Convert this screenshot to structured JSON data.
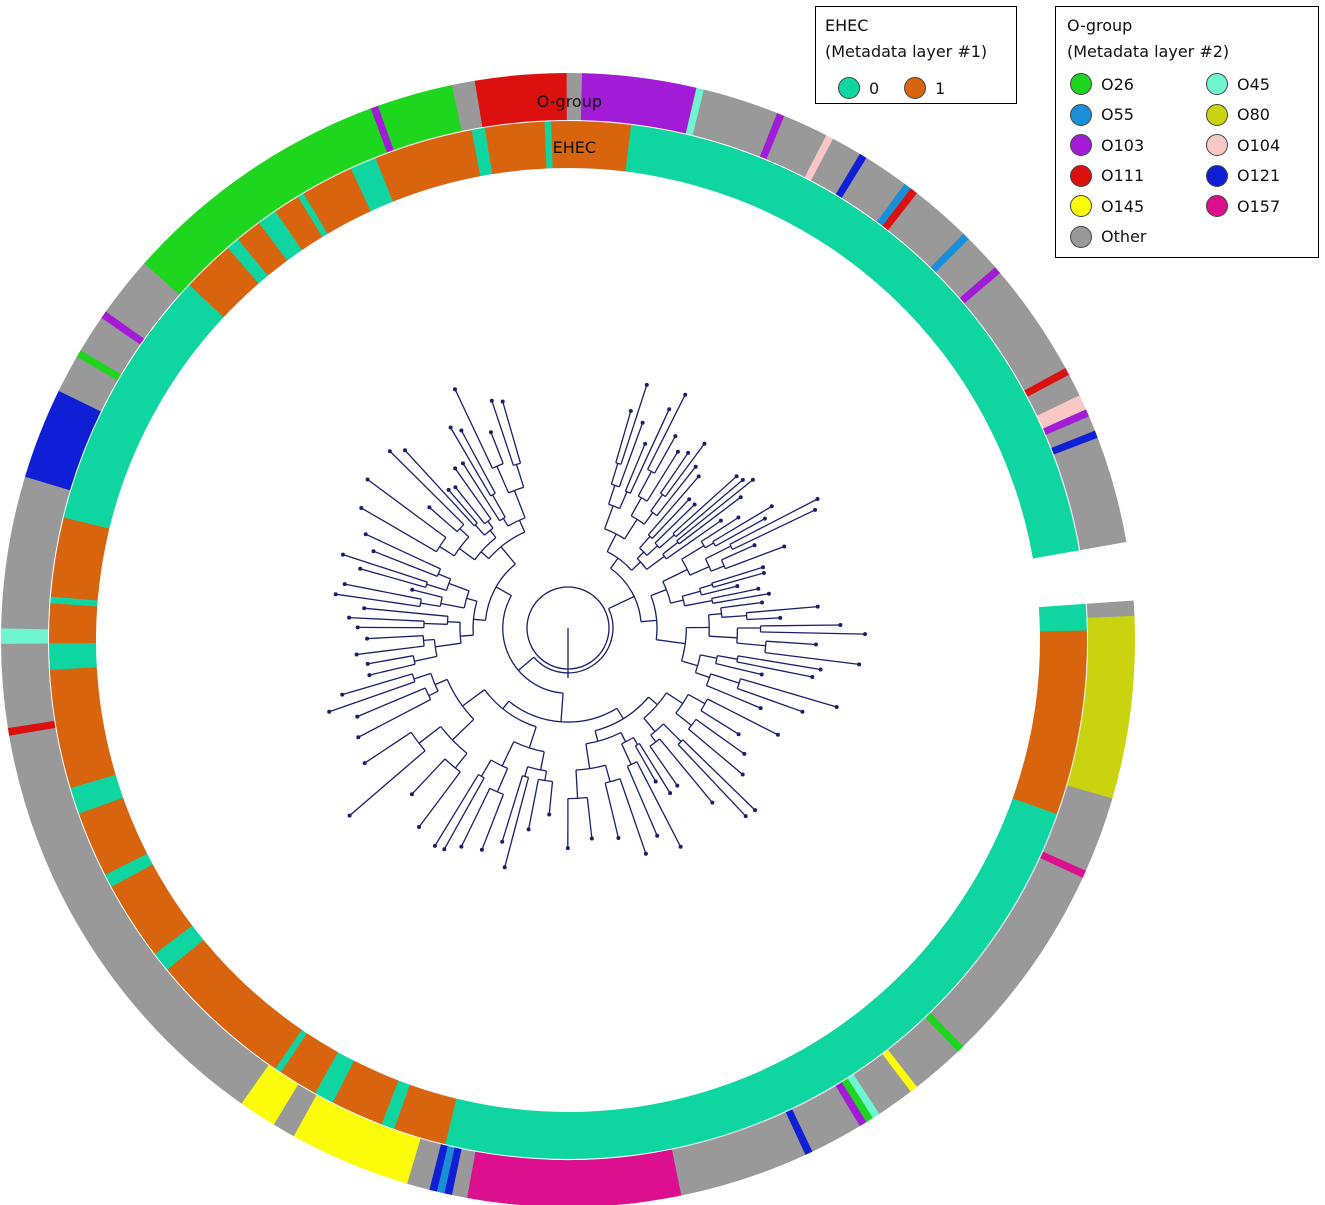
{
  "figure": {
    "ring_labels": {
      "outer": "O-group",
      "inner": "EHEC"
    },
    "tree_color": "#1b1f6b"
  },
  "legend_ehec": {
    "title_line1": "EHEC",
    "title_line2": "(Metadata layer #1)",
    "items": [
      {
        "label": "0",
        "color": "#0fd6a0"
      },
      {
        "label": "1",
        "color": "#d8640e"
      }
    ]
  },
  "legend_ogroup": {
    "title_line1": "O-group",
    "title_line2": "(Metadata layer #2)",
    "items": [
      {
        "label": "O26",
        "color": "#1ed61e",
        "icon": "circle-swatch"
      },
      {
        "label": "O45",
        "color": "#6ff5d0",
        "icon": "circle-swatch"
      },
      {
        "label": "O55",
        "color": "#1a8fd8",
        "icon": "circle-swatch"
      },
      {
        "label": "O80",
        "color": "#c9d30f",
        "icon": "circle-swatch"
      },
      {
        "label": "O103",
        "color": "#a21bd6",
        "icon": "circle-swatch"
      },
      {
        "label": "O104",
        "color": "#f9c7c4",
        "icon": "circle-swatch"
      },
      {
        "label": "O111",
        "color": "#dd1010",
        "icon": "circle-swatch"
      },
      {
        "label": "O121",
        "color": "#0e1fd6",
        "icon": "circle-swatch"
      },
      {
        "label": "O145",
        "color": "#fbfb0a",
        "icon": "circle-swatch"
      },
      {
        "label": "O157",
        "color": "#dc0f8f",
        "icon": "circle-swatch"
      },
      {
        "label": "Other",
        "color": "#999999",
        "icon": "circle-swatch"
      }
    ]
  },
  "ehec_ring": [
    [
      "0",
      4
    ],
    [
      "1",
      28
    ],
    [
      "0",
      114
    ],
    [
      "1",
      8
    ],
    [
      "0",
      2
    ],
    [
      "1",
      8
    ],
    [
      "0",
      3
    ],
    [
      "1",
      6
    ],
    [
      "0",
      1
    ],
    [
      "1",
      22
    ],
    [
      "0",
      3
    ],
    [
      "1",
      12
    ],
    [
      "0",
      2
    ],
    [
      "1",
      10
    ],
    [
      "0",
      4
    ],
    [
      "1",
      18
    ],
    [
      "0",
      4
    ],
    [
      "1",
      6
    ],
    [
      "0",
      1
    ],
    [
      "1",
      12
    ],
    [
      "0",
      40
    ],
    [
      "1",
      8
    ],
    [
      "0",
      2
    ],
    [
      "1",
      4
    ],
    [
      "0",
      3
    ],
    [
      "1",
      4
    ],
    [
      "0",
      1
    ],
    [
      "1",
      8
    ],
    [
      "0",
      4
    ],
    [
      "1",
      15
    ],
    [
      "0",
      2
    ],
    [
      "1",
      9
    ],
    [
      "0",
      1
    ],
    [
      "1",
      12
    ],
    [
      "0",
      99
    ]
  ],
  "ogroup_ring": [
    [
      "Other",
      2
    ],
    [
      "O80",
      24
    ],
    [
      "Other",
      10
    ],
    [
      "O157",
      1
    ],
    [
      "Other",
      27
    ],
    [
      "O26",
      1
    ],
    [
      "Other",
      7
    ],
    [
      "O145",
      1
    ],
    [
      "Other",
      5
    ],
    [
      "O45",
      1
    ],
    [
      "O26",
      1
    ],
    [
      "O103",
      1
    ],
    [
      "Other",
      7
    ],
    [
      "O121",
      1
    ],
    [
      "Other",
      17
    ],
    [
      "O157",
      28
    ],
    [
      "Other",
      2
    ],
    [
      "O121",
      1
    ],
    [
      "O55",
      1
    ],
    [
      "O121",
      1
    ],
    [
      "Other",
      3
    ],
    [
      "O145",
      16
    ],
    [
      "Other",
      3
    ],
    [
      "O145",
      5
    ],
    [
      "Other",
      58
    ],
    [
      "O111",
      1
    ],
    [
      "Other",
      11
    ],
    [
      "O45",
      1
    ],
    [
      "O45",
      1
    ],
    [
      "Other",
      20
    ],
    [
      "O121",
      12
    ],
    [
      "Other",
      5
    ],
    [
      "O26",
      1
    ],
    [
      "Other",
      5
    ],
    [
      "O103",
      1
    ],
    [
      "Other",
      8
    ],
    [
      "O26",
      36
    ],
    [
      "O103",
      1
    ],
    [
      "O26",
      10
    ],
    [
      "Other",
      3
    ],
    [
      "O111",
      12
    ],
    [
      "Other",
      2
    ],
    [
      "O103",
      15
    ],
    [
      "O45",
      1
    ],
    [
      "Other",
      10
    ],
    [
      "O103",
      1
    ],
    [
      "Other",
      6
    ],
    [
      "O104",
      1
    ],
    [
      "Other",
      4
    ],
    [
      "O121",
      1
    ],
    [
      "Other",
      6
    ],
    [
      "O55",
      1
    ],
    [
      "O111",
      1
    ],
    [
      "Other",
      8
    ],
    [
      "O55",
      1
    ],
    [
      "Other",
      5
    ],
    [
      "O103",
      1
    ],
    [
      "Other",
      15
    ],
    [
      "O111",
      1
    ],
    [
      "Other",
      3
    ],
    [
      "O104",
      2
    ],
    [
      "O103",
      1
    ],
    [
      "Other",
      2
    ],
    [
      "O121",
      1
    ],
    [
      "Other",
      14
    ]
  ]
}
